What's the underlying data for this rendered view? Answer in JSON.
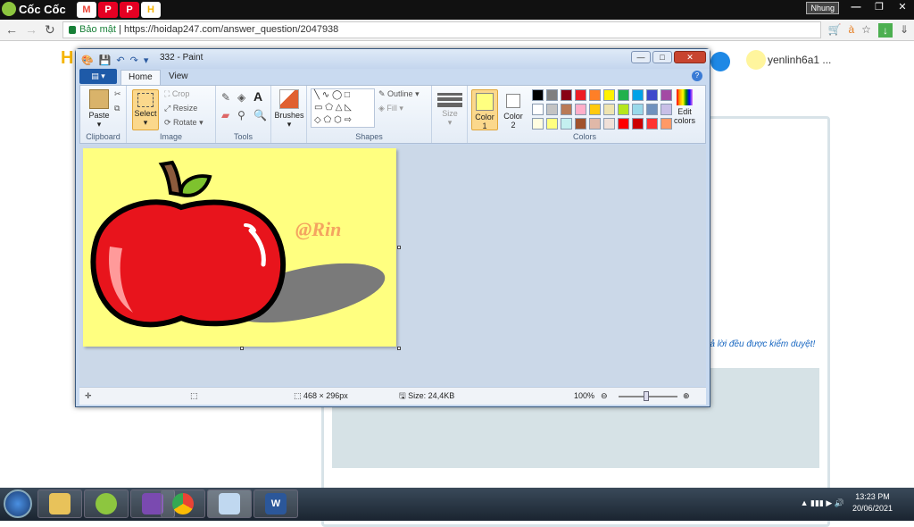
{
  "browser": {
    "brand": "Cốc Cốc",
    "tabs": [
      {
        "icon": "gmail-icon",
        "label": "M",
        "color": "#ea4335"
      },
      {
        "icon": "pinterest-icon",
        "label": "P",
        "color": "#e60023"
      },
      {
        "icon": "pinterest-icon",
        "label": "P",
        "color": "#e60023"
      },
      {
        "icon": "hoidap-icon",
        "label": "H",
        "color": "#f5b400"
      }
    ],
    "user": "Nhung",
    "security": "Bảo mật",
    "url": "https://hoidap247.com/answer_question/2047938"
  },
  "site": {
    "username": "yenlinh6a1 ...",
    "notice": "rả lời đều được kiểm duyệt!"
  },
  "paint": {
    "title": "332 - Paint",
    "tabs": {
      "home": "Home",
      "view": "View"
    },
    "clipboard": {
      "paste": "Paste",
      "label": "Clipboard"
    },
    "image": {
      "select": "Select",
      "crop": "Crop",
      "resize": "Resize",
      "rotate": "Rotate",
      "label": "Image"
    },
    "tools": {
      "label": "Tools",
      "text": "A"
    },
    "brushes": "Brushes",
    "shapes": {
      "outline": "Outline",
      "fill": "Fill",
      "label": "Shapes"
    },
    "size": "Size",
    "color1": "Color\n1",
    "color1_a": "Color",
    "color1_b": "1",
    "color2_a": "Color",
    "color2_b": "2",
    "colors_label": "Colors",
    "edit_colors_a": "Edit",
    "edit_colors_b": "colors",
    "palette": [
      "#000000",
      "#7f7f7f",
      "#880015",
      "#ed1c24",
      "#ff7f27",
      "#fff200",
      "#22b14c",
      "#00a2e8",
      "#3f48cc",
      "#a349a4",
      "#ffffff",
      "#c3c3c3",
      "#b97a57",
      "#ffaec9",
      "#ffc90e",
      "#efe4b0",
      "#b5e61d",
      "#99d9ea",
      "#7092be",
      "#c8bfe7",
      "#fffde0",
      "#ffff80",
      "#c4f0f0",
      "#a0522d",
      "#e0b8a8",
      "#f0e0d8",
      "#ff0000",
      "#cc0000",
      "#ff3333",
      "#ff9966"
    ],
    "color1_value": "#ffff80",
    "color2_value": "#ffffff",
    "watermark": "@Rin",
    "status": {
      "dimensions": "468 × 296px",
      "size": "Size: 24,4KB",
      "zoom": "100%"
    }
  },
  "taskbar": {
    "time": "13:23 PM",
    "date": "20/06/2021"
  }
}
